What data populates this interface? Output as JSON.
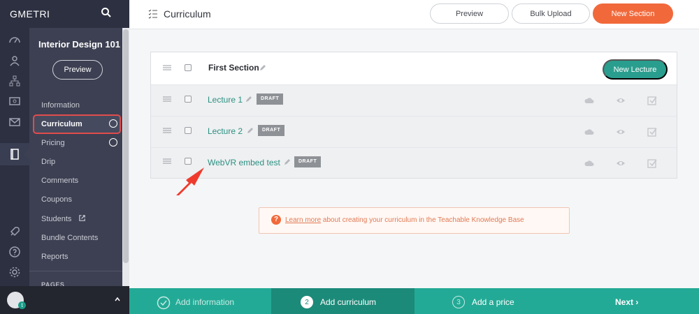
{
  "brand": "GMETRI",
  "course": {
    "title": "Interior Design 101",
    "preview_label": "Preview"
  },
  "nav": {
    "items": [
      {
        "label": "Information"
      },
      {
        "label": "Curriculum"
      },
      {
        "label": "Pricing"
      },
      {
        "label": "Drip"
      },
      {
        "label": "Comments"
      },
      {
        "label": "Coupons"
      },
      {
        "label": "Students"
      },
      {
        "label": "Bundle Contents"
      },
      {
        "label": "Reports"
      }
    ],
    "pages_label": "PAGES"
  },
  "avatar_badge": "t",
  "header": {
    "title": "Curriculum",
    "preview_label": "Preview",
    "bulk_upload_label": "Bulk Upload",
    "new_section_label": "New Section"
  },
  "section": {
    "title": "First Section",
    "new_lecture_label": "New Lecture",
    "lectures": [
      {
        "title": "Lecture 1",
        "status": "DRAFT"
      },
      {
        "title": "Lecture 2",
        "status": "DRAFT"
      },
      {
        "title": "WebVR embed test",
        "status": "DRAFT"
      }
    ]
  },
  "kb": {
    "link_text": "Learn more",
    "text": " about creating your curriculum in the Teachable Knowledge Base"
  },
  "stepper": {
    "steps": [
      {
        "num": "",
        "label": "Add information"
      },
      {
        "num": "2",
        "label": "Add curriculum"
      },
      {
        "num": "3",
        "label": "Add a price"
      }
    ],
    "next_label": "Next ›"
  },
  "colors": {
    "accent_orange": "#f1693b",
    "accent_teal": "#2a9e8e",
    "sidebar_dark": "#2d3040"
  }
}
